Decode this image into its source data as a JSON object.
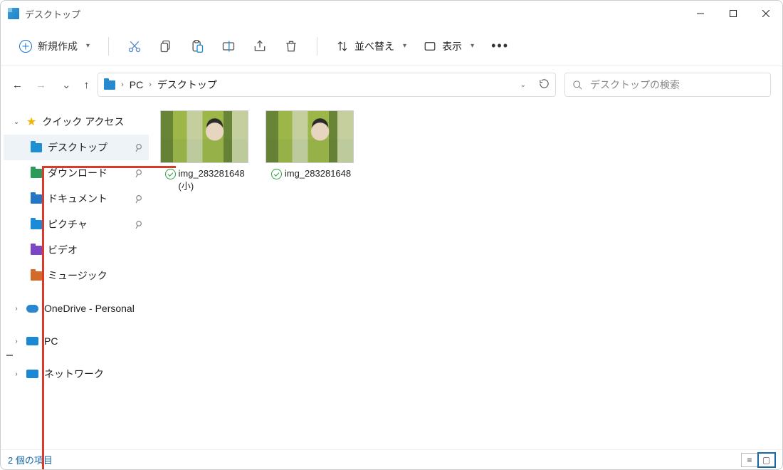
{
  "window": {
    "title": "デスクトップ"
  },
  "toolbar": {
    "new_label": "新規作成",
    "sort_label": "並べ替え",
    "view_label": "表示"
  },
  "breadcrumb": {
    "root": "PC",
    "current": "デスクトップ"
  },
  "search": {
    "placeholder": "デスクトップの検索"
  },
  "sidebar": {
    "quick_access": "クイック アクセス",
    "items": [
      {
        "label": "デスクトップ",
        "pinned": true,
        "selected": true
      },
      {
        "label": "ダウンロード",
        "pinned": true
      },
      {
        "label": "ドキュメント",
        "pinned": true
      },
      {
        "label": "ピクチャ",
        "pinned": true
      },
      {
        "label": "ビデオ"
      },
      {
        "label": "ミュージック"
      }
    ],
    "onedrive": "OneDrive - Personal",
    "pc": "PC",
    "network": "ネットワーク"
  },
  "files": [
    {
      "name": "img_283281648 (小)"
    },
    {
      "name": "img_283281648"
    }
  ],
  "status": {
    "text": "2 個の項目"
  }
}
